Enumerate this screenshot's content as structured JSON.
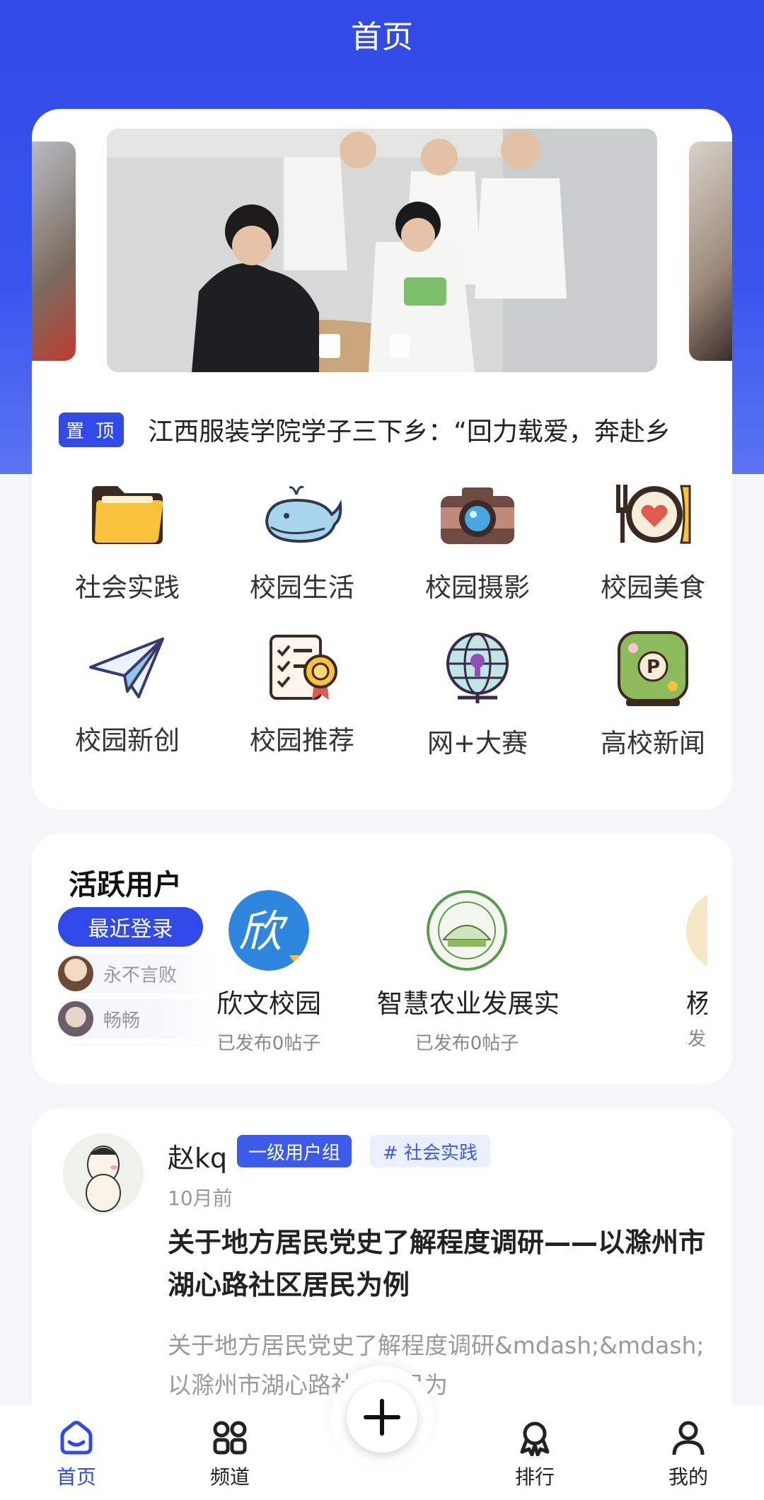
{
  "header": {
    "title": "首页"
  },
  "notice": {
    "badge": "置 顶",
    "text": "江西服装学院学子三下乡：“回力载爱，奔赴乡"
  },
  "categories": [
    {
      "label": "社会实践",
      "icon": "folder-icon"
    },
    {
      "label": "校园生活",
      "icon": "whale-icon"
    },
    {
      "label": "校园摄影",
      "icon": "camera-icon"
    },
    {
      "label": "校园美食",
      "icon": "plate-icon"
    },
    {
      "label": "校园新创",
      "icon": "paper-plane-icon"
    },
    {
      "label": "校园推荐",
      "icon": "checklist-award-icon"
    },
    {
      "label": "网+大赛",
      "icon": "globe-icon"
    },
    {
      "label": "高校新闻",
      "icon": "parking-sign-icon"
    }
  ],
  "active_users": {
    "title": "活跃用户",
    "recent_button": "最近登录",
    "recent": [
      {
        "name": "永不言败"
      },
      {
        "name": "畅畅"
      }
    ],
    "users": [
      {
        "name": "欣文校园",
        "posts": "已发布0帖子"
      },
      {
        "name": "智慧农业发展实",
        "posts": "已发布0帖子"
      },
      {
        "name": "杨",
        "posts": "已发"
      }
    ]
  },
  "post": {
    "author": "赵kq",
    "group_tag": "一级用户组",
    "topic_tag": "# 社会实践",
    "time": "10月前",
    "title": "关于地方居民党史了解程度调研——以滁州市湖心路社区居民为例",
    "excerpt": "关于地方居民党史了解程度调研&mdash;&mdash;以滁州市湖心路社区居民为"
  },
  "nav": {
    "home": "首页",
    "channels": "频道",
    "ranking": "排行",
    "mine": "我的"
  },
  "colors": {
    "primary": "#3149e6",
    "tag_bg": "#eaf0ff"
  }
}
